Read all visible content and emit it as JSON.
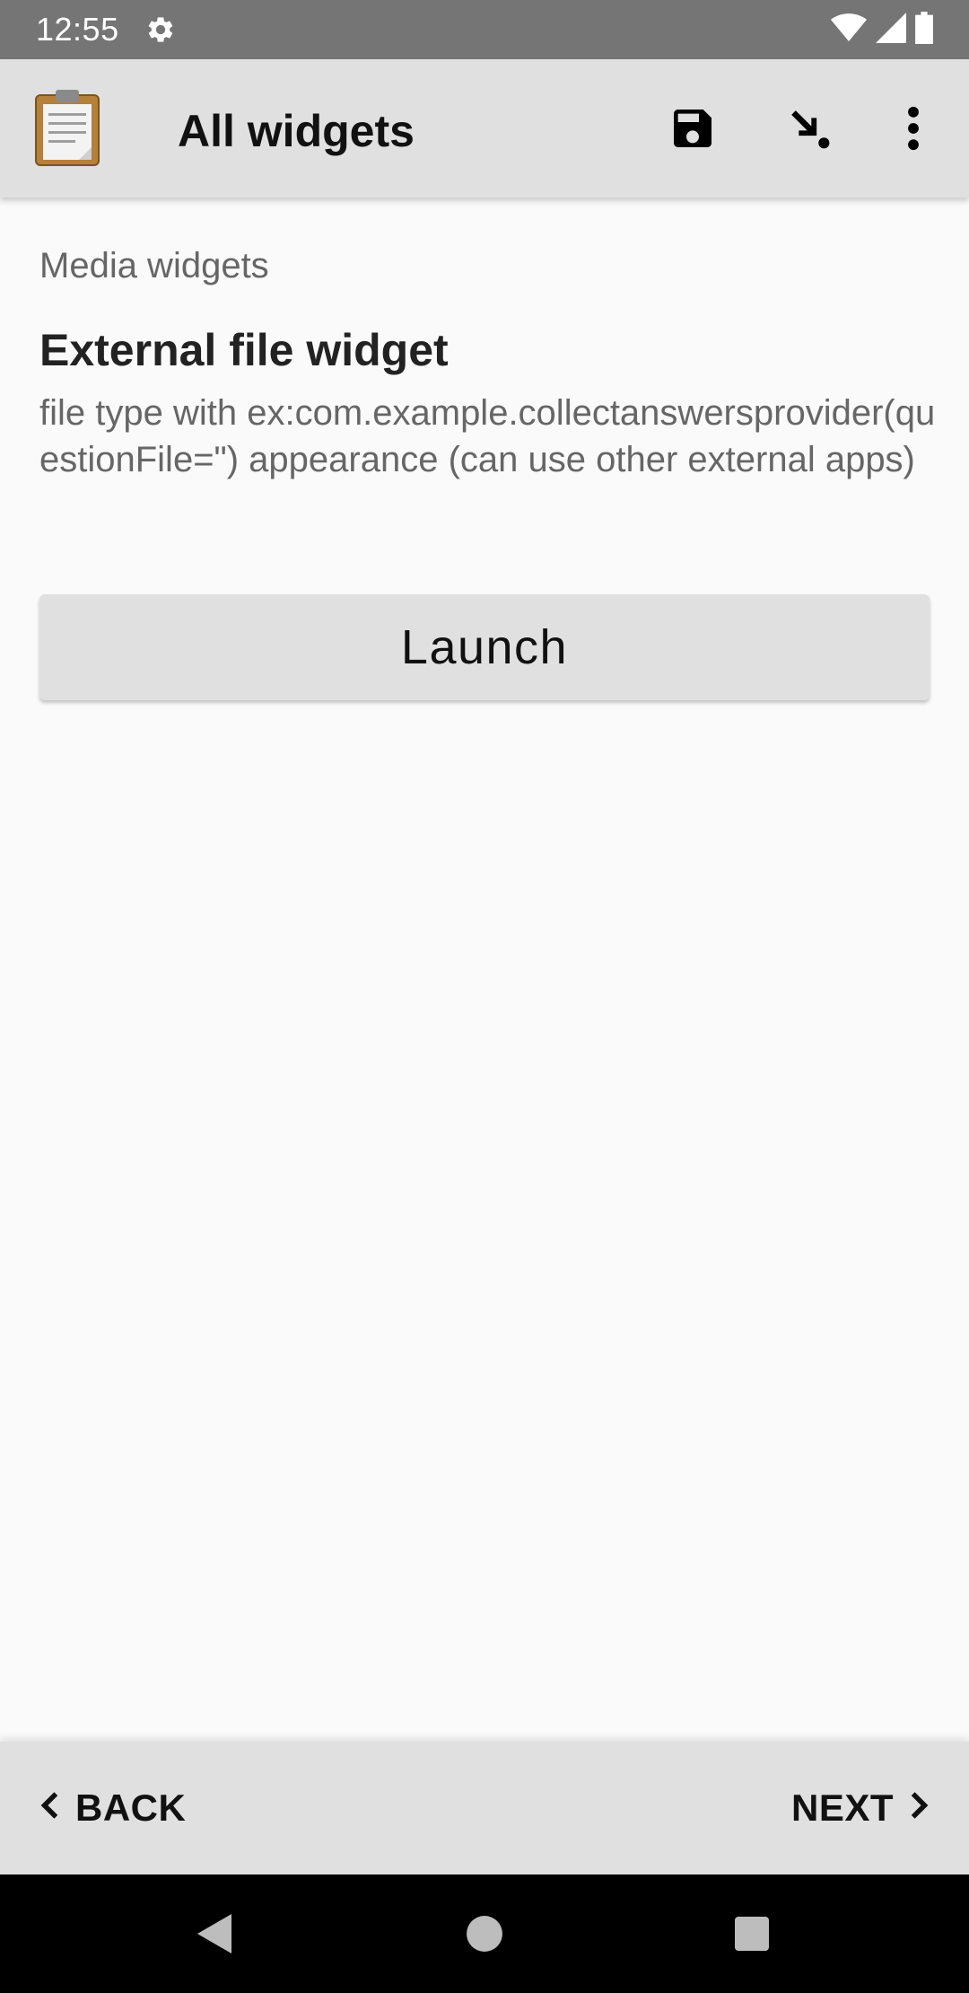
{
  "status_bar": {
    "time": "12:55",
    "icons": [
      "settings-gear-icon",
      "wifi-icon",
      "signal-icon",
      "battery-icon"
    ]
  },
  "app_bar": {
    "title": "All widgets",
    "logo_icon": "clipboard-icon",
    "actions": [
      "save-icon",
      "jump-to-icon",
      "overflow-menu-icon"
    ]
  },
  "form": {
    "group_label": "Media widgets",
    "question_title": "External file widget",
    "question_hint": "file type with ex:com.example.collectanswersprovider(questionFile=\") appearance (can use other external apps)",
    "launch_label": "Launch"
  },
  "navigation": {
    "back_label": "BACK",
    "next_label": "NEXT"
  },
  "system_nav": [
    "back-triangle-icon",
    "home-circle-icon",
    "recents-square-icon"
  ],
  "colors": {
    "status_bar": "#757575",
    "app_bar": "#e0e0e0",
    "background": "#fafafa",
    "button": "#e0e0e0",
    "system_nav": "#000000"
  }
}
